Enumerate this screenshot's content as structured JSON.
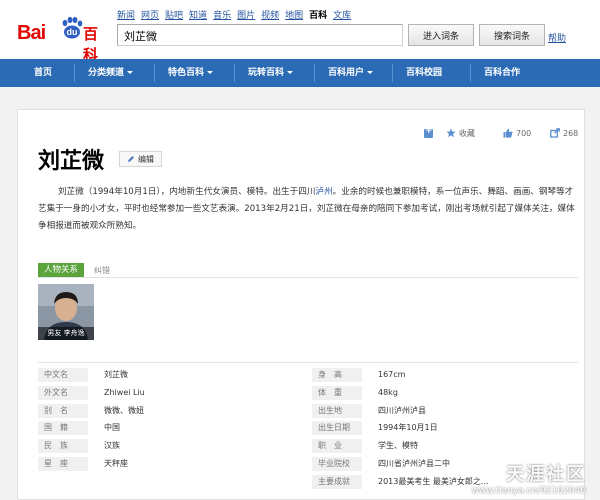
{
  "logo": {
    "bai": "Bai",
    "du": "du",
    "baike": "百科"
  },
  "topnav": [
    "新闻",
    "网页",
    "贴吧",
    "知道",
    "音乐",
    "图片",
    "视频",
    "地图",
    "百科",
    "文库"
  ],
  "topnav_current_index": 8,
  "search": {
    "value": "刘芷微"
  },
  "buttons": {
    "enter": "进入词条",
    "search": "搜索词条",
    "help": "帮助"
  },
  "mainnav": [
    {
      "label": "首页",
      "dropdown": false
    },
    {
      "label": "分类频道",
      "dropdown": true
    },
    {
      "label": "特色百科",
      "dropdown": true
    },
    {
      "label": "玩转百科",
      "dropdown": true
    },
    {
      "label": "百科用户",
      "dropdown": true
    },
    {
      "label": "百科校园",
      "dropdown": false
    },
    {
      "label": "百科合作",
      "dropdown": false
    }
  ],
  "entry": {
    "title": "刘芷微",
    "edit_label": "编辑",
    "actions": {
      "favorite": "收藏",
      "likes": "700",
      "shares": "268"
    },
    "desc_before": "刘芷微（1994年10月1日），内地新生代女演员、模特。出生于四川",
    "desc_link": "泸州",
    "desc_after": "。业余的时候也兼职模特，系一位声乐、舞蹈、画画、钢琴等才艺集于一身的小才女，平时也经常参加一些文艺表演。2013年2月21日，刘芷微在母亲的陪同下参加考试，刚出考场就引起了媒体关注，媒体争相报道而被观众所熟知。"
  },
  "relations": {
    "tab_active": "人物关系",
    "tab_other": "纠错",
    "photo_caption": "男友 李舟逸"
  },
  "info": {
    "left": [
      {
        "label": "中文名",
        "value": "刘芷微"
      },
      {
        "label": "外文名",
        "value": "Zhiwei Liu"
      },
      {
        "label": "别　名",
        "value": "微微、微妞"
      },
      {
        "label": "国　籍",
        "value": "中国"
      },
      {
        "label": "民　族",
        "value": "汉族"
      },
      {
        "label": "星　座",
        "value": "天秤座"
      }
    ],
    "right": [
      {
        "label": "身　高",
        "value": "167cm"
      },
      {
        "label": "体　重",
        "value": "48kg"
      },
      {
        "label": "出生地",
        "value": "四川泸州泸县"
      },
      {
        "label": "出生日期",
        "value": "1994年10月1日"
      },
      {
        "label": "职　业",
        "value": "学生、模特"
      },
      {
        "label": "毕业院校",
        "value": "四川省泸州泸县二中"
      },
      {
        "label": "主要成就",
        "value": "2013最美考生  最美泸女郎之..."
      }
    ]
  },
  "watermark": {
    "site": "天涯社区",
    "url": "www.tianya.cn/92162040"
  },
  "colors": {
    "nav_blue": "#2b6bb5",
    "brand_red": "#e10602",
    "tab_green": "#5ba33b",
    "link_blue": "#2553a0"
  }
}
